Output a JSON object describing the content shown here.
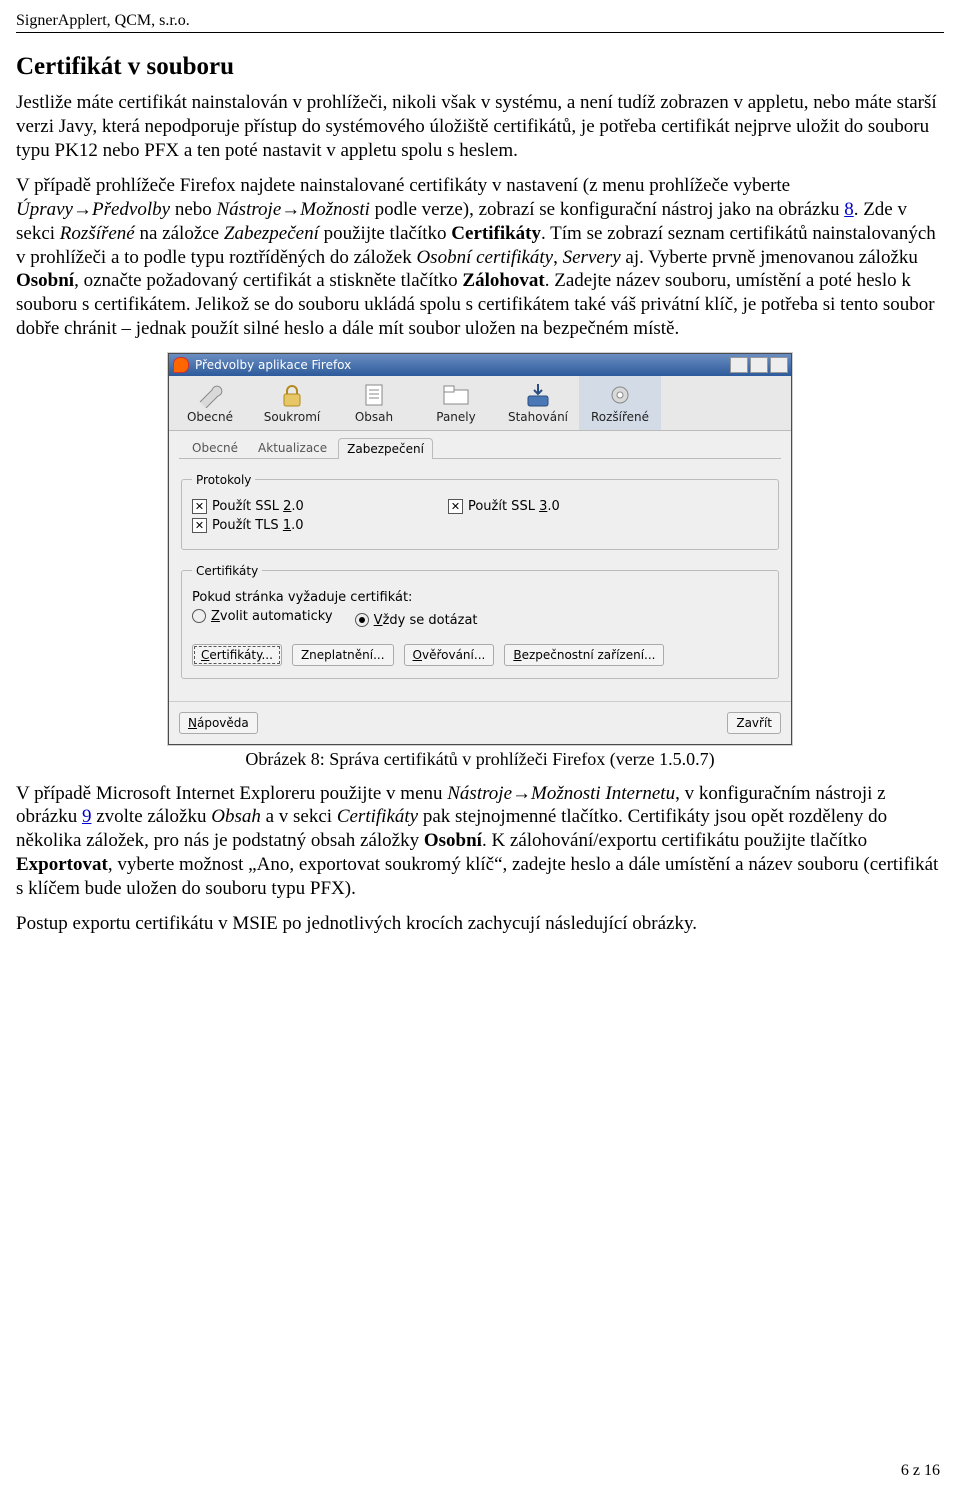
{
  "header": "SignerApplert, QCM, s.r.o.",
  "title": "Certifikát v souboru",
  "para1": "Jestliže máte certifikát nainstalován v prohlížeči, nikoli však v systému, a není tudíž zobrazen v appletu, nebo máte starší verzi Javy, která nepodporuje přístup do systémového úložiště certifikátů, je potřeba certifikát nejprve uložit do souboru typu PK12 nebo PFX a ten poté nastavit v appletu spolu s heslem.",
  "p2a": "V případě prohlížeče Firefox najdete nainstalované certifikáty v nastavení (z menu prohlížeče vyberte ",
  "p2b": "Úpravy→Předvolby",
  "p2c": " nebo ",
  "p2d": "Nástroje→Možnosti",
  "p2e": " podle verze), zobrazí se konfigurační nástroj jako na obrázku ",
  "p2link": "8",
  "p2f": ". Zde v sekci ",
  "p2g": "Rozšířené",
  "p2h": " na záložce ",
  "p2i": "Zabezpečení",
  "p2j": " použijte tlačítko ",
  "p2k": "Certifikáty",
  "p2l": ". Tím se zobrazí seznam certifikátů nainstalovaných v prohlížeči a to podle typu roztříděných do záložek ",
  "p2m": "Osobní certifikáty",
  "p2n": ", ",
  "p2o": "Servery",
  "p2p": " aj. Vyberte prvně jmenovanou záložku ",
  "p2q": "Osobní",
  "p2r": ", označte požadovaný certifikát a stiskněte tlačítko ",
  "p2s": "Zálohovat",
  "p2t": ". Zadejte název souboru, umístění a poté heslo k souboru s certifikátem. Jelikož se do souboru ukládá spolu s certifikátem také váš privátní klíč, je potřeba si tento soubor dobře chránit – jednak použít silné heslo a dále mít soubor uložen na bezpečném místě.",
  "caption": "Obrázek 8: Správa certifikátů v prohlížeči Firefox (verze 1.5.0.7)",
  "p3a": "V případě Microsoft Internet Exploreru použijte v menu ",
  "p3b": "Nástroje→Možnosti Internetu",
  "p3c": ", v konfiguračním nástroji z obrázku ",
  "p3link": "9",
  "p3d": " zvolte záložku ",
  "p3e": "Obsah",
  "p3f": " a v sekci ",
  "p3g": "Certifikáty",
  "p3h": " pak stejnojmenné tlačítko. Certifikáty jsou opět rozděleny do několika záložek, pro nás je podstatný obsah záložky ",
  "p3i": "Osobní",
  "p3j": ". K zálohování/exportu certifikátu použijte tlačítko ",
  "p3k": "Exportovat",
  "p3l": ", vyberte možnost „Ano, exportovat soukromý klíč“, zadejte heslo a dále umístění a název souboru (certifikát s klíčem bude uložen do souboru typu PFX).",
  "para4": "Postup exportu certifikátu v MSIE po jednotlivých krocích zachycují následující obrázky.",
  "footer": "6 z 16",
  "ff": {
    "title": "Předvolby aplikace Firefox",
    "cats": [
      "Obecné",
      "Soukromí",
      "Obsah",
      "Panely",
      "Stahování",
      "Rozšířené"
    ],
    "subtabs": [
      "Obecné",
      "Aktualizace",
      "Zabezpečení"
    ],
    "proto_legend": "Protokoly",
    "ssl2_a": "Použít SSL ",
    "ssl2_b": "2",
    "ssl2_c": ".0",
    "ssl3_a": "Použít SSL ",
    "ssl3_b": "3",
    "ssl3_c": ".0",
    "tls_a": "Použít TLS ",
    "tls_b": "1",
    "tls_c": ".0",
    "cert_legend": "Certifikáty",
    "cert_text": "Pokud stránka vyžaduje certifikát:",
    "r1a": "Z",
    "r1b": "volit automaticky",
    "r2a": "V",
    "r2b": "ždy se dotázat",
    "b1a": "C",
    "b1b": "ertifikáty...",
    "b2": "Zneplatnění...",
    "b3a": "O",
    "b3b": "věřování...",
    "b4a": "B",
    "b4b": "ezpečnostní zařízení...",
    "help_a": "N",
    "help_b": "ápověda",
    "close": "Zavřít"
  }
}
